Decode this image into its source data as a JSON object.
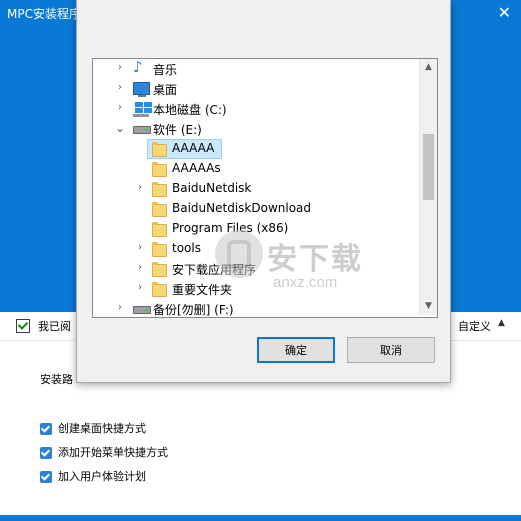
{
  "installer": {
    "title": "MPC安装程序",
    "close_glyph": "✕",
    "agree_label": "我已阅",
    "custom_label": "自定义",
    "custom_caret": "▲",
    "install_path_label": "安装路",
    "options": [
      {
        "label": "创建桌面快捷方式",
        "checked": true
      },
      {
        "label": "添加开始菜单快捷方式",
        "checked": true
      },
      {
        "label": "加入用户体验计划",
        "checked": true
      }
    ],
    "accent_color": "#0a79d6"
  },
  "dialog": {
    "tree": [
      {
        "label": "音乐",
        "icon": "music-icon",
        "expander": "›"
      },
      {
        "label": "桌面",
        "icon": "desktop-icon",
        "expander": "›"
      },
      {
        "label": "本地磁盘 (C:)",
        "icon": "windows-drive-icon",
        "expander": "›"
      },
      {
        "label": "软件 (E:)",
        "icon": "drive-icon",
        "expander": "⌄"
      },
      {
        "label": "AAAAA",
        "icon": "folder-icon",
        "expander": "",
        "selected": true
      },
      {
        "label": "AAAAAs",
        "icon": "folder-icon",
        "expander": ""
      },
      {
        "label": "BaiduNetdisk",
        "icon": "folder-icon",
        "expander": "›"
      },
      {
        "label": "BaiduNetdiskDownload",
        "icon": "folder-icon",
        "expander": ""
      },
      {
        "label": "Program Files (x86)",
        "icon": "folder-icon",
        "expander": ""
      },
      {
        "label": "tools",
        "icon": "folder-icon",
        "expander": "›"
      },
      {
        "label": "安下载应用程序",
        "icon": "folder-icon",
        "expander": "›"
      },
      {
        "label": "重要文件夹",
        "icon": "folder-icon",
        "expander": "›"
      },
      {
        "label": "备份[勿删] (F:)",
        "icon": "drive-icon",
        "expander": "›"
      }
    ],
    "scroll_up": "▲",
    "scroll_down": "▼",
    "ok_label": "确定",
    "cancel_label": "取消"
  },
  "watermark": {
    "text": "安下载",
    "url": "anxz.com"
  }
}
